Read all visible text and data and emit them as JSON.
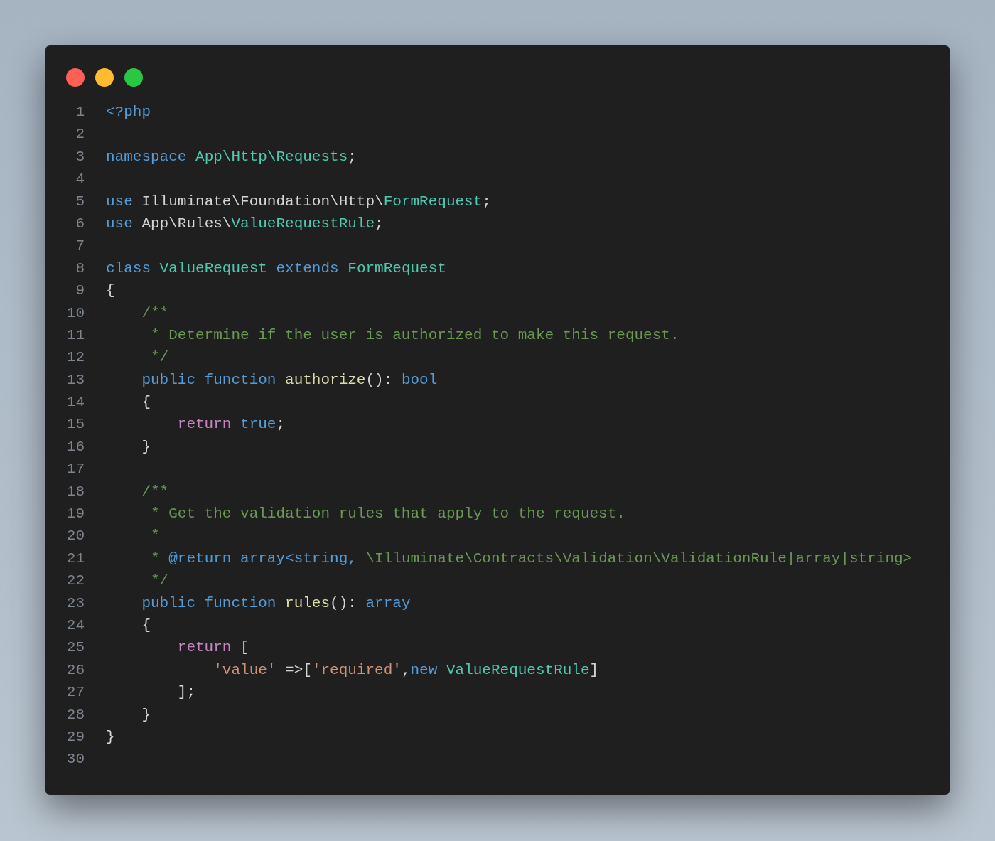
{
  "window": {
    "controls": [
      {
        "color": "#ff5f57"
      },
      {
        "color": "#febc2e"
      },
      {
        "color": "#28c840"
      }
    ]
  },
  "lines": [
    {
      "number": "1",
      "tokens": [
        {
          "kind": "keyword",
          "text": "<?php"
        }
      ]
    },
    {
      "number": "2"
    },
    {
      "number": "3",
      "tokens": [
        {
          "kind": "keyword",
          "text": "namespace"
        },
        {
          "kind": "type",
          "text": " App\\Http\\Requests"
        },
        {
          "kind": "plain",
          "text": ";"
        }
      ]
    },
    {
      "number": "4"
    },
    {
      "number": "5",
      "tokens": [
        {
          "kind": "keyword",
          "text": "use"
        },
        {
          "kind": "plain",
          "text": " Illuminate\\Foundation\\Http\\"
        },
        {
          "kind": "type",
          "text": "FormRequest"
        },
        {
          "kind": "plain",
          "text": ";"
        }
      ]
    },
    {
      "number": "6",
      "tokens": [
        {
          "kind": "keyword",
          "text": "use"
        },
        {
          "kind": "plain",
          "text": " App\\Rules\\"
        },
        {
          "kind": "type",
          "text": "ValueRequestRule"
        },
        {
          "kind": "plain",
          "text": ";"
        }
      ]
    },
    {
      "number": "7"
    },
    {
      "number": "8",
      "tokens": [
        {
          "kind": "keyword",
          "text": "class"
        },
        {
          "kind": "type",
          "text": " ValueRequest"
        },
        {
          "kind": "keyword",
          "text": " extends"
        },
        {
          "kind": "type",
          "text": " FormRequest"
        }
      ]
    },
    {
      "number": "9",
      "tokens": [
        {
          "kind": "plain",
          "text": "{"
        }
      ]
    },
    {
      "number": "10",
      "tokens": [
        {
          "kind": "comment",
          "text": "    /**"
        }
      ]
    },
    {
      "number": "11",
      "tokens": [
        {
          "kind": "comment",
          "text": "     * Determine if the user is authorized to make this request."
        }
      ]
    },
    {
      "number": "12",
      "tokens": [
        {
          "kind": "comment",
          "text": "     */"
        }
      ]
    },
    {
      "number": "13",
      "tokens": [
        {
          "kind": "keyword",
          "text": "    public function"
        },
        {
          "kind": "function",
          "text": " authorize"
        },
        {
          "kind": "plain",
          "text": "(): "
        },
        {
          "kind": "keyword",
          "text": "bool"
        }
      ]
    },
    {
      "number": "14",
      "tokens": [
        {
          "kind": "plain",
          "text": "    {"
        }
      ]
    },
    {
      "number": "15",
      "tokens": [
        {
          "kind": "control",
          "text": "        return"
        },
        {
          "kind": "keyword",
          "text": " true"
        },
        {
          "kind": "plain",
          "text": ";"
        }
      ]
    },
    {
      "number": "16",
      "tokens": [
        {
          "kind": "plain",
          "text": "    }"
        }
      ]
    },
    {
      "number": "17"
    },
    {
      "number": "18",
      "tokens": [
        {
          "kind": "comment",
          "text": "    /**"
        }
      ]
    },
    {
      "number": "19",
      "tokens": [
        {
          "kind": "comment",
          "text": "     * Get the validation rules that apply to the request."
        }
      ]
    },
    {
      "number": "20",
      "tokens": [
        {
          "kind": "comment",
          "text": "     *"
        }
      ]
    },
    {
      "number": "21",
      "tokens": [
        {
          "kind": "comment",
          "text": "     *"
        },
        {
          "kind": "doctag",
          "text": " @return"
        },
        {
          "kind": "keyword",
          "text": " array<string,"
        },
        {
          "kind": "comment",
          "text": " \\Illuminate\\Contracts\\Validation\\ValidationRule|array|string>"
        }
      ]
    },
    {
      "number": "22",
      "tokens": [
        {
          "kind": "comment",
          "text": "     */"
        }
      ]
    },
    {
      "number": "23",
      "tokens": [
        {
          "kind": "keyword",
          "text": "    public function"
        },
        {
          "kind": "function",
          "text": " rules"
        },
        {
          "kind": "plain",
          "text": "(): "
        },
        {
          "kind": "keyword",
          "text": "array"
        }
      ]
    },
    {
      "number": "24",
      "tokens": [
        {
          "kind": "plain",
          "text": "    {"
        }
      ]
    },
    {
      "number": "25",
      "tokens": [
        {
          "kind": "control",
          "text": "        return"
        },
        {
          "kind": "plain",
          "text": " ["
        }
      ]
    },
    {
      "number": "26",
      "tokens": [
        {
          "kind": "string",
          "text": "            'value'"
        },
        {
          "kind": "plain",
          "text": " =>["
        },
        {
          "kind": "string",
          "text": "'required'"
        },
        {
          "kind": "plain",
          "text": ","
        },
        {
          "kind": "keyword",
          "text": "new"
        },
        {
          "kind": "type",
          "text": " ValueRequestRule"
        },
        {
          "kind": "plain",
          "text": "]"
        }
      ]
    },
    {
      "number": "27",
      "tokens": [
        {
          "kind": "plain",
          "text": "        ];"
        }
      ]
    },
    {
      "number": "28",
      "tokens": [
        {
          "kind": "plain",
          "text": "    }"
        }
      ]
    },
    {
      "number": "29",
      "tokens": [
        {
          "kind": "plain",
          "text": "}"
        }
      ]
    },
    {
      "number": "30"
    }
  ]
}
